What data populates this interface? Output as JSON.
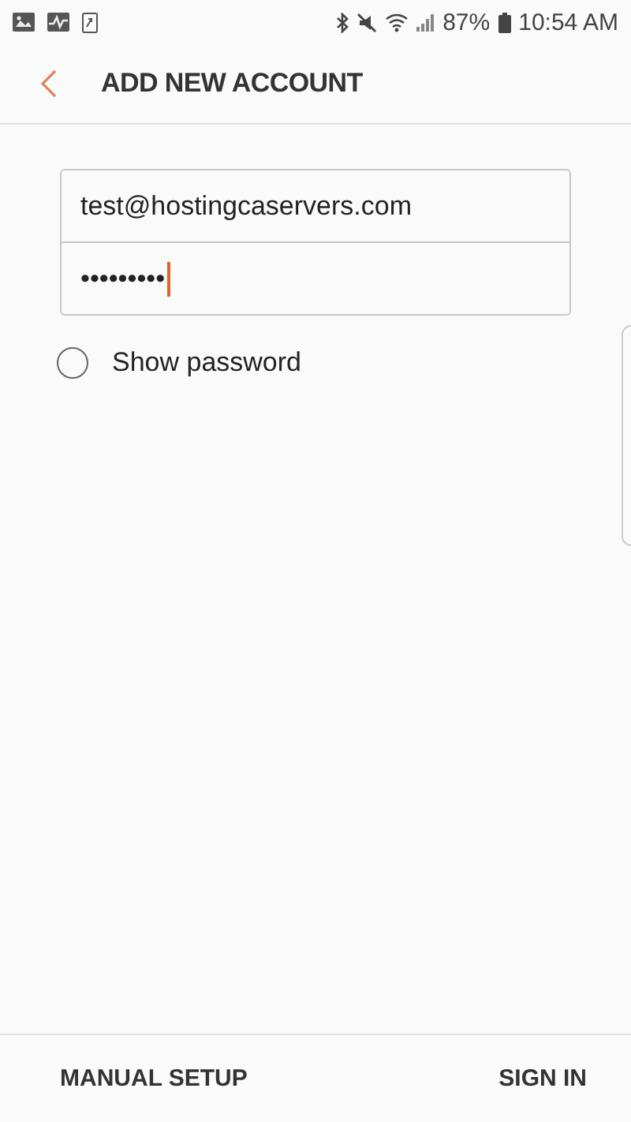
{
  "status_bar": {
    "battery": "87%",
    "time": "10:54 AM"
  },
  "header": {
    "title": "ADD NEW ACCOUNT"
  },
  "form": {
    "email": "test@hostingcaservers.com",
    "password": "•••••••••",
    "show_password": {
      "label": "Show password",
      "checked": false
    }
  },
  "footer": {
    "buttons": [
      "MANUAL SETUP",
      "SIGN IN"
    ]
  }
}
